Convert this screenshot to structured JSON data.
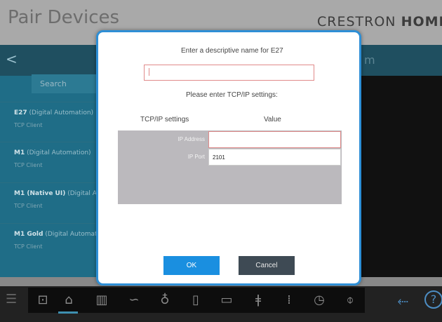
{
  "app": {
    "title": "Pair Devices",
    "brand_light": "CRESTRON ",
    "brand_bold": "HOME"
  },
  "nav": {
    "back": "<",
    "right_text": "m"
  },
  "sidebar": {
    "search_placeholder": "Search",
    "devices": [
      {
        "name": "E27",
        "detail": " (Digital Automation)",
        "type": "TCP Client"
      },
      {
        "name": "M1",
        "detail": " (Digital Automation)",
        "type": "TCP Client"
      },
      {
        "name": "M1 (Native UI)",
        "detail": " (Digital Automation)",
        "type": "TCP Client"
      },
      {
        "name": "M1 Gold",
        "detail": " (Digital Automation)",
        "type": "TCP Client"
      }
    ]
  },
  "dialog": {
    "name_prompt": "Enter a descriptive name for E27",
    "name_value": "",
    "tcp_prompt": "Please enter TCP/IP settings:",
    "col_settings": "TCP/IP settings",
    "col_value": "Value",
    "ip_label": "IP Address",
    "ip_value": "",
    "port_label": "IP Port",
    "port_value": "2101",
    "ok_label": "OK",
    "cancel_label": "Cancel"
  },
  "toolbar": {
    "icons": [
      "menu-icon",
      "add-device-icon",
      "wifi-router-icon",
      "doors-icon",
      "automation-flow-icon",
      "lightbulb-icon",
      "shades-icon",
      "media-icon",
      "thermometer-icon",
      "keypad-icon",
      "clock-icon",
      "temperature-gauge-icon",
      "back-arrow-icon",
      "help-icon"
    ],
    "help_glyph": "?",
    "back_glyph": "⬸"
  },
  "colors": {
    "accent": "#1a8fe0",
    "modal_border": "#2e8fd6",
    "panel": "#1f6d87",
    "error_border": "#e08a8a"
  }
}
